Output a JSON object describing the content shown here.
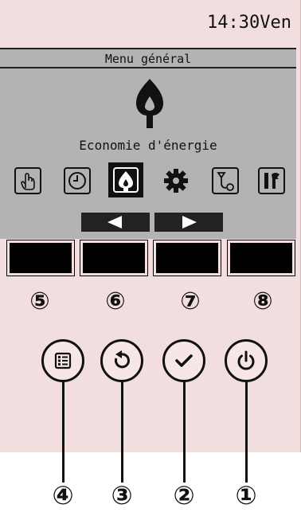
{
  "header": {
    "time": "14:30Ven"
  },
  "menu": {
    "title": "Menu général",
    "current_mode": "Economie d'énergie"
  },
  "menu_icons": [
    {
      "name": "hand-touch-icon",
      "selected": false
    },
    {
      "name": "clock-icon",
      "selected": false
    },
    {
      "name": "energy-saving-icon",
      "selected": true
    },
    {
      "name": "gear-icon",
      "selected": false
    },
    {
      "name": "maintenance-filter-icon",
      "selected": false
    },
    {
      "name": "service-wrench-icon",
      "selected": false
    }
  ],
  "function_labels": [
    "⑤",
    "⑥",
    "⑦",
    "⑧"
  ],
  "button_callouts": [
    "④",
    "③",
    "②",
    "①"
  ],
  "buttons": [
    {
      "name": "menu-button",
      "icon": "menu-list-icon"
    },
    {
      "name": "return-button",
      "icon": "return-icon"
    },
    {
      "name": "select-button",
      "icon": "check-icon"
    },
    {
      "name": "power-button",
      "icon": "power-icon"
    }
  ],
  "colors": {
    "panel": "#f2dede",
    "screen": "#b3b3b3",
    "dark": "#111111"
  }
}
